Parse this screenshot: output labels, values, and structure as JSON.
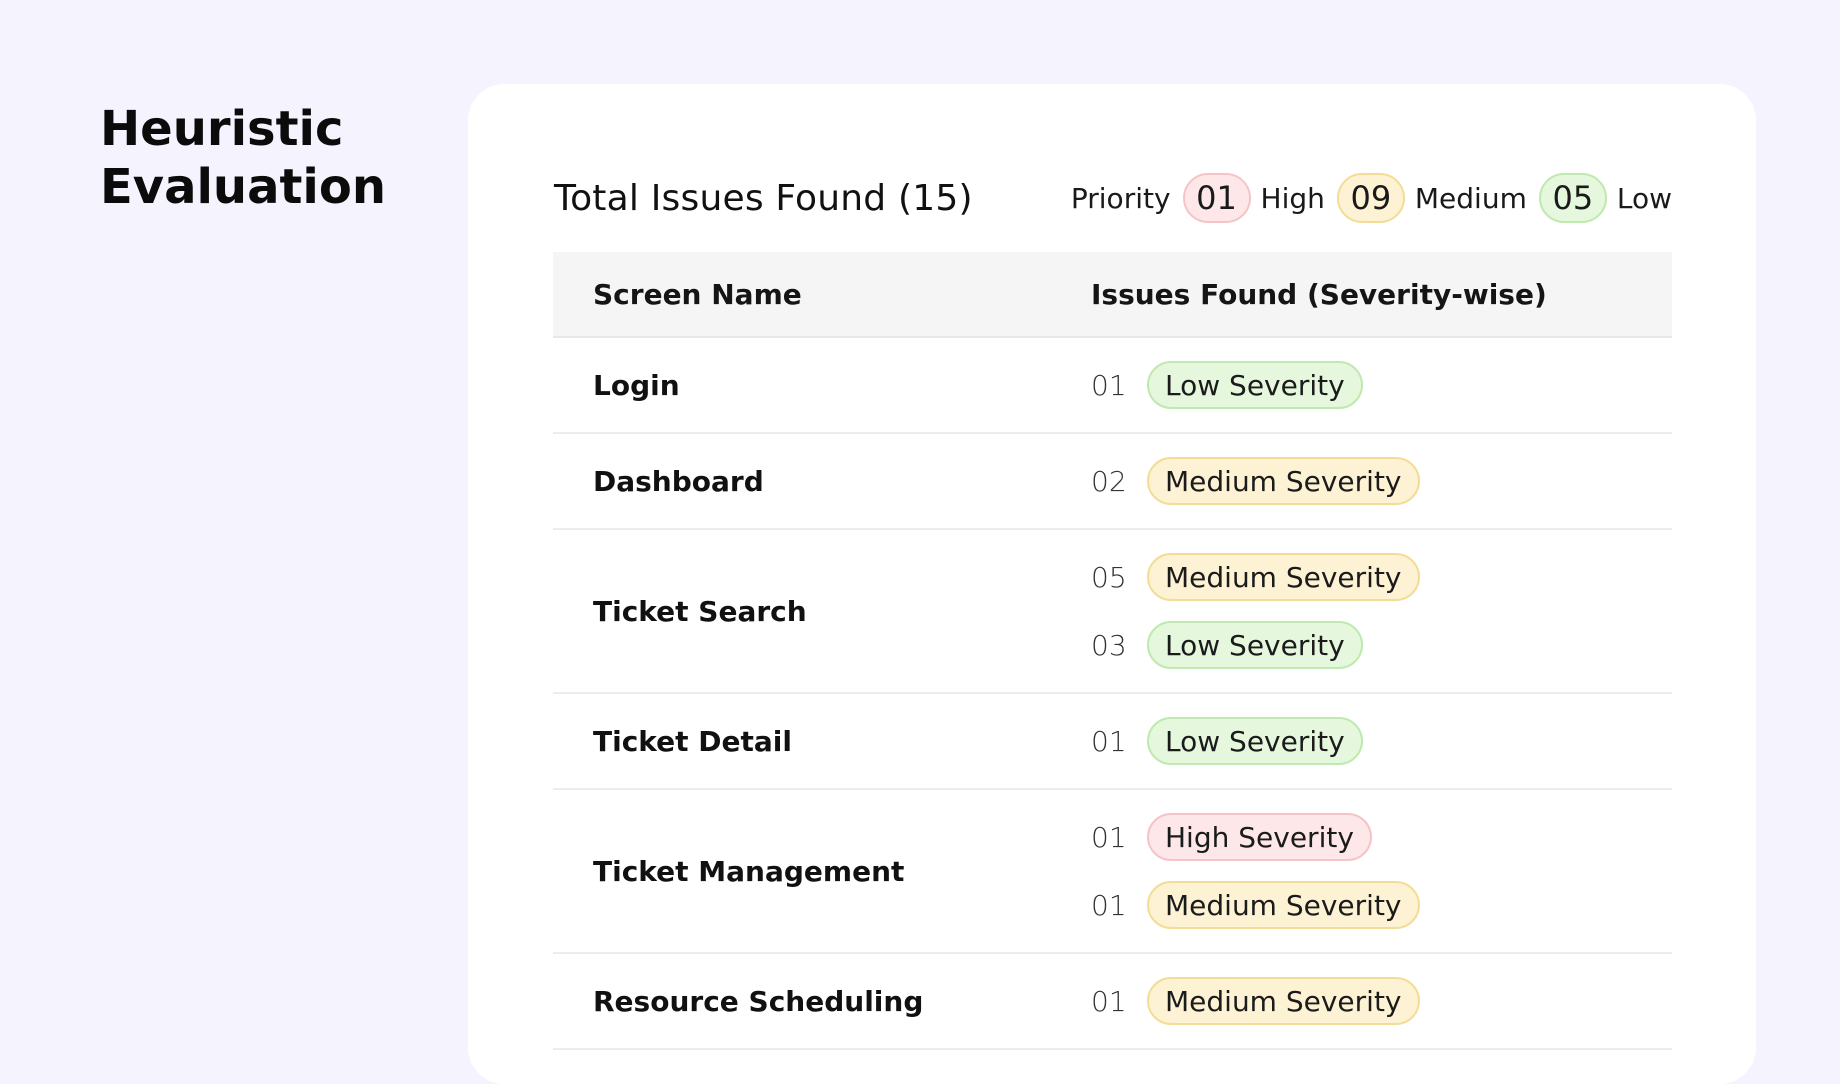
{
  "page": {
    "title_line1": "Heuristic",
    "title_line2": "Evaluation"
  },
  "summary": {
    "title": "Total Issues Found (15)",
    "priority_label": "Priority",
    "levels": [
      {
        "count": "01",
        "label": "High",
        "tone": "high"
      },
      {
        "count": "09",
        "label": "Medium",
        "tone": "medium"
      },
      {
        "count": "05",
        "label": "Low",
        "tone": "low"
      }
    ]
  },
  "table": {
    "headers": {
      "screen": "Screen Name",
      "issues": "Issues Found (Severity-wise)"
    },
    "rows": [
      {
        "screen": "Login",
        "issues": [
          {
            "count": "01",
            "severity": "Low Severity",
            "tone": "low"
          }
        ]
      },
      {
        "screen": "Dashboard",
        "issues": [
          {
            "count": "02",
            "severity": "Medium Severity",
            "tone": "medium"
          }
        ]
      },
      {
        "screen": "Ticket Search",
        "issues": [
          {
            "count": "05",
            "severity": "Medium Severity",
            "tone": "medium"
          },
          {
            "count": "03",
            "severity": "Low Severity",
            "tone": "low"
          }
        ]
      },
      {
        "screen": "Ticket Detail",
        "issues": [
          {
            "count": "01",
            "severity": "Low Severity",
            "tone": "low"
          }
        ]
      },
      {
        "screen": "Ticket Management",
        "issues": [
          {
            "count": "01",
            "severity": "High Severity",
            "tone": "high"
          },
          {
            "count": "01",
            "severity": "Medium Severity",
            "tone": "medium"
          }
        ]
      },
      {
        "screen": "Resource Scheduling",
        "issues": [
          {
            "count": "01",
            "severity": "Medium Severity",
            "tone": "medium"
          }
        ]
      }
    ]
  },
  "colors": {
    "background": "#f4f3fe",
    "card": "#ffffff",
    "high_fill": "#fde7e8",
    "medium_fill": "#fdf3d4",
    "low_fill": "#e5f8de"
  }
}
